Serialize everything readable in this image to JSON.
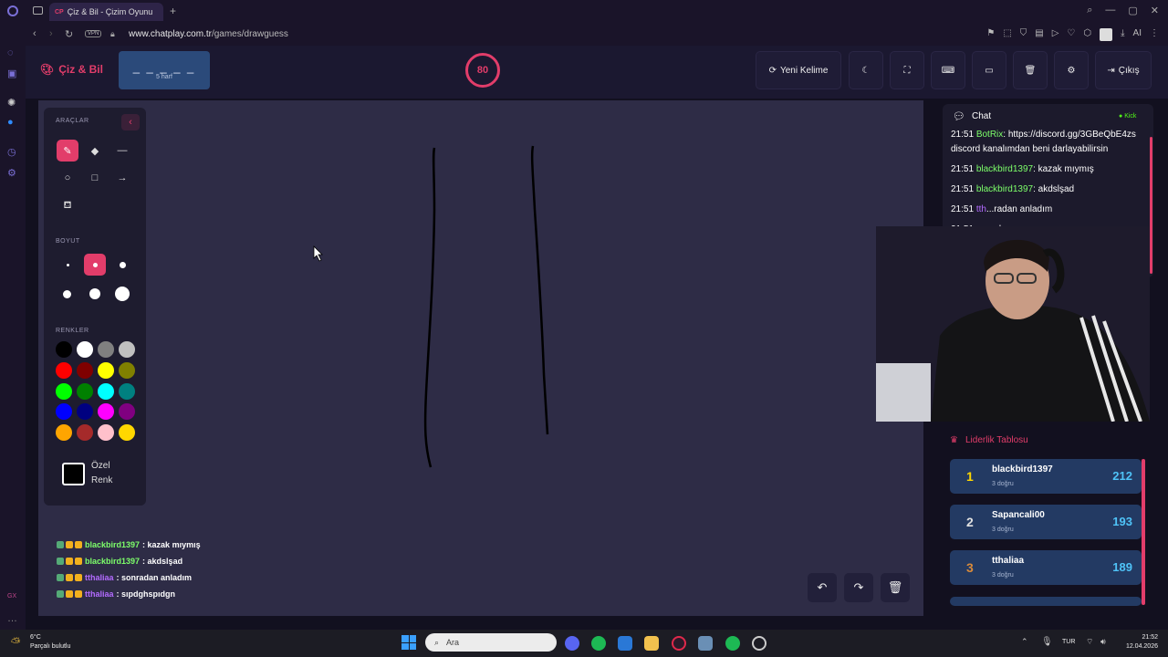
{
  "browser": {
    "tab_title": "Çiz & Bil - Çizim Oyunu",
    "tab_favicon": "CP",
    "vpn_label": "VPN",
    "url_host": "www.chatplay.com.tr",
    "url_path": "/games/drawguess",
    "ai_label": "AI"
  },
  "header": {
    "logo": "Çiz & Bil",
    "word_dashes": "_ _ _ _ _",
    "word_length": "5 harf",
    "timer": "80",
    "new_word": "Yeni Kelime",
    "exit": "Çıkış"
  },
  "tools": {
    "section_tools": "ARAÇLAR",
    "section_size": "BOYUT",
    "section_colors": "RENKLER",
    "custom_color_line1": "Özel",
    "custom_color_line2": "Renk",
    "colors": [
      "#000000",
      "#ffffff",
      "#808080",
      "#c0c0c0",
      "#ff0000",
      "#800000",
      "#ffff00",
      "#808000",
      "#00ff00",
      "#008000",
      "#00ffff",
      "#008080",
      "#0000ff",
      "#000080",
      "#ff00ff",
      "#800080",
      "#ffa500",
      "#a52a2a",
      "#ffc0cb",
      "#ffd700"
    ]
  },
  "canvas_chat": [
    {
      "user": "blackbird1397",
      "user_color": "#7dff6a",
      "text": ": kazak mıymış"
    },
    {
      "user": "blackbird1397",
      "user_color": "#7dff6a",
      "text": ": akdslşad"
    },
    {
      "user": "tthaliaa",
      "user_color": "#b36bff",
      "text": ": sonradan anladım"
    },
    {
      "user": "tthaliaa",
      "user_color": "#b36bff",
      "text": ": sıpdghspıdgn"
    }
  ],
  "chat": {
    "title": "Chat",
    "platform": "Kick",
    "messages": [
      {
        "time": "21:51",
        "user": "BotRix",
        "user_color": "#7dff6a",
        "text": ": https://discord.gg/3GBeQbE4zs discord kanalımdan beni darlayabilirsin"
      },
      {
        "time": "21:51",
        "user": "blackbird1397",
        "user_color": "#7dff6a",
        "text": ": kazak mıymış"
      },
      {
        "time": "21:51",
        "user": "blackbird1397",
        "user_color": "#7dff6a",
        "text": ": akdslşad"
      },
      {
        "time": "21:51",
        "user": "tth",
        "user_color": "#b36bff",
        "text": "...radan anladım"
      },
      {
        "time": "21:51",
        "user": "",
        "user_color": "#b36bff",
        "text": "...spıdgn"
      }
    ]
  },
  "leaderboard": {
    "title": "Liderlik Tablosu",
    "rows": [
      {
        "rank": "1",
        "rank_color": "#ffd700",
        "name": "blackbird1397",
        "sub": "3 doğru",
        "score": "212"
      },
      {
        "rank": "2",
        "rank_color": "#e0e0e0",
        "name": "Sapancali00",
        "sub": "3 doğru",
        "score": "193"
      },
      {
        "rank": "3",
        "rank_color": "#d88a3a",
        "name": "tthaliaa",
        "sub": "3 doğru",
        "score": "189"
      }
    ]
  },
  "taskbar": {
    "weather_temp": "6°C",
    "weather_desc": "Parçalı bulutlu",
    "search": "Ara",
    "lang": "TUR",
    "time": "21:52",
    "date": "12.04.2026"
  }
}
